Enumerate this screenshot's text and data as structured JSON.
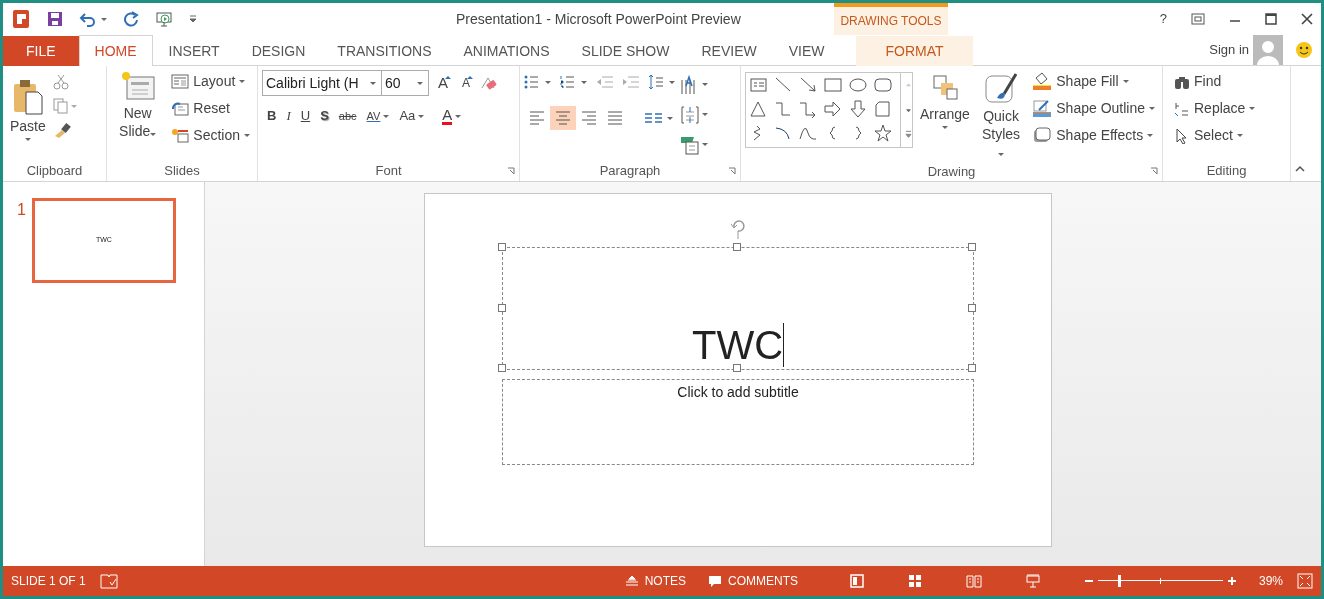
{
  "window": {
    "title": "Presentation1 - Microsoft PowerPoint Preview",
    "help": "?"
  },
  "contextual_group": "DRAWING TOOLS",
  "tabs": [
    {
      "label": "FILE",
      "kind": "file",
      "selected": false
    },
    {
      "label": "HOME",
      "kind": "normal",
      "selected": true
    },
    {
      "label": "INSERT",
      "kind": "normal",
      "selected": false
    },
    {
      "label": "DESIGN",
      "kind": "normal",
      "selected": false
    },
    {
      "label": "TRANSITIONS",
      "kind": "normal",
      "selected": false
    },
    {
      "label": "ANIMATIONS",
      "kind": "normal",
      "selected": false
    },
    {
      "label": "SLIDE SHOW",
      "kind": "normal",
      "selected": false
    },
    {
      "label": "REVIEW",
      "kind": "normal",
      "selected": false
    },
    {
      "label": "VIEW",
      "kind": "normal",
      "selected": false
    },
    {
      "label": "FORMAT",
      "kind": "contextual",
      "selected": false
    }
  ],
  "account": {
    "sign_in": "Sign in"
  },
  "ribbon": {
    "clipboard": {
      "label": "Clipboard",
      "paste": "Paste"
    },
    "slides": {
      "label": "Slides",
      "new_slide": "New Slide",
      "items": [
        {
          "label": "Layout",
          "kind": "layout"
        },
        {
          "label": "Reset",
          "kind": "reset"
        },
        {
          "label": "Section",
          "kind": "section"
        }
      ]
    },
    "font": {
      "label": "Font",
      "font_name": "Calibri Light (H",
      "font_size": "60",
      "size_buttons": [
        {
          "label": "A",
          "kind": "grow"
        },
        {
          "label": "A",
          "kind": "shrink"
        }
      ],
      "format_buttons": [
        {
          "label": "B",
          "kind": "bold"
        },
        {
          "label": "I",
          "kind": "italic"
        },
        {
          "label": "U",
          "kind": "underline"
        },
        {
          "label": "S",
          "kind": "shadow"
        },
        {
          "label": "abc",
          "kind": "strike"
        },
        {
          "label": "AV",
          "kind": "spacing"
        },
        {
          "label": "Aa",
          "kind": "case"
        }
      ],
      "color_button": "A"
    },
    "paragraph": {
      "label": "Paragraph",
      "alignments": [
        {
          "kind": "left",
          "selected": false
        },
        {
          "kind": "center",
          "selected": true
        },
        {
          "kind": "right",
          "selected": false
        },
        {
          "kind": "justify",
          "selected": false
        }
      ]
    },
    "drawing": {
      "label": "Drawing",
      "arrange": "Arrange",
      "quick_styles": "Quick Styles",
      "shape_commands": [
        {
          "label": "Shape Fill",
          "kind": "fill"
        },
        {
          "label": "Shape Outline",
          "kind": "outline"
        },
        {
          "label": "Shape Effects",
          "kind": "effects"
        }
      ]
    },
    "editing": {
      "label": "Editing",
      "commands": [
        {
          "label": "Find",
          "kind": "find"
        },
        {
          "label": "Replace",
          "kind": "replace"
        },
        {
          "label": "Select",
          "kind": "select"
        }
      ]
    }
  },
  "thumbnails": [
    {
      "number": "1",
      "text": "TWC",
      "selected": true
    }
  ],
  "slide": {
    "title": "TWC",
    "subtitle_placeholder": "Click to add subtitle"
  },
  "status_bar": {
    "slide_info": "SLIDE 1 OF 1",
    "notes": "NOTES",
    "comments": "COMMENTS",
    "zoom": {
      "level": 0.17
    },
    "zoom_percent": "39%"
  }
}
